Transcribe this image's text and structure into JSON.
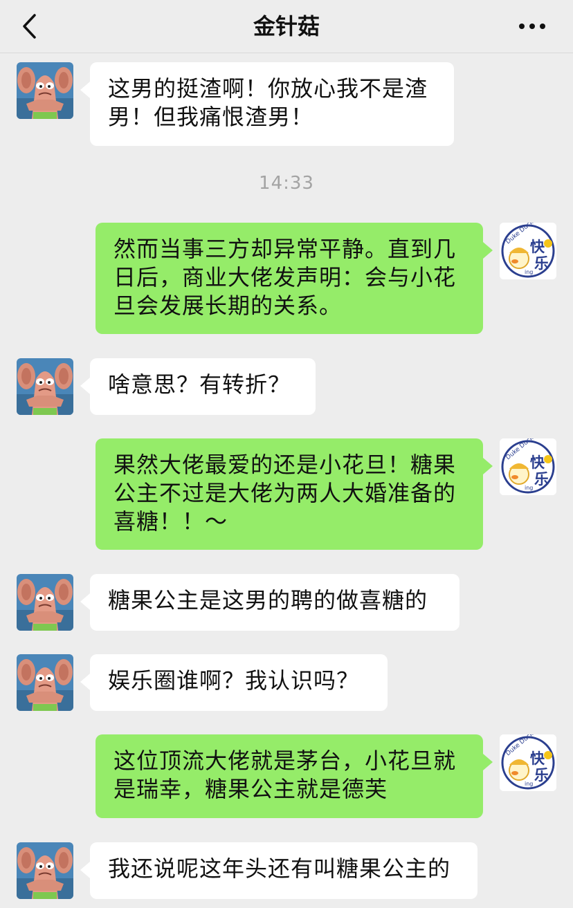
{
  "header": {
    "title": "金针菇",
    "back_icon": "chevron-left-icon",
    "more_icon": "more-dots-icon"
  },
  "timestamp": "14:33",
  "colors": {
    "background": "#ededed",
    "incoming_bubble": "#ffffff",
    "outgoing_bubble": "#95ec69",
    "timestamp_text": "#a3a3a3"
  },
  "avatars": {
    "contact": "starfish-character-avatar",
    "me": "duck-kuaile-ing-avatar",
    "me_text": "快乐",
    "me_small_text": "Duke Duck",
    "me_ing": "ing"
  },
  "messages": [
    {
      "side": "in",
      "text": "这男的挺渣啊！你放心我不是渣男！但我痛恨渣男！"
    },
    {
      "side": "out",
      "text": "然而当事三方却异常平静。直到几日后，商业大佬发声明：会与小花旦会发展长期的关系。"
    },
    {
      "side": "in",
      "text": "啥意思？有转折？"
    },
    {
      "side": "out",
      "text": "果然大佬最爱的还是小花旦！糖果公主不过是大佬为两人大婚准备的喜糖！！～"
    },
    {
      "side": "in",
      "text": "糖果公主是这男的聘的做喜糖的"
    },
    {
      "side": "in",
      "text": "娱乐圈谁啊？我认识吗？"
    },
    {
      "side": "out",
      "text": "这位顶流大佬就是茅台，小花旦就是瑞幸，糖果公主就是德芙"
    },
    {
      "side": "in",
      "text": "我还说呢这年头还有叫糖果公主的"
    }
  ]
}
